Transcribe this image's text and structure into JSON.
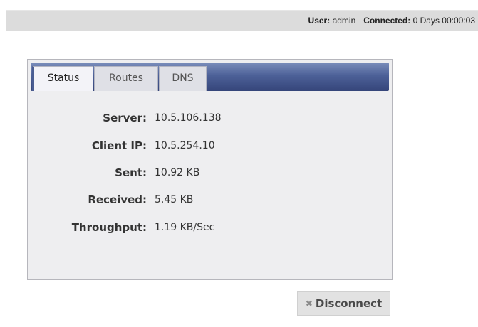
{
  "header": {
    "user_label": "User:",
    "user_value": "admin",
    "connected_label": "Connected:",
    "connected_value": "0 Days 00:00:03"
  },
  "tabs": [
    {
      "label": "Status",
      "active": true
    },
    {
      "label": "Routes",
      "active": false
    },
    {
      "label": "DNS",
      "active": false
    }
  ],
  "status": {
    "rows": [
      {
        "label": "Server:",
        "value": "10.5.106.138"
      },
      {
        "label": "Client IP:",
        "value": "10.5.254.10"
      },
      {
        "label": "Sent:",
        "value": "10.92 KB"
      },
      {
        "label": "Received:",
        "value": "5.45 KB"
      },
      {
        "label": "Throughput:",
        "value": "1.19 KB/Sec"
      }
    ]
  },
  "actions": {
    "disconnect_label": "Disconnect",
    "disconnect_icon": "close-icon"
  }
}
